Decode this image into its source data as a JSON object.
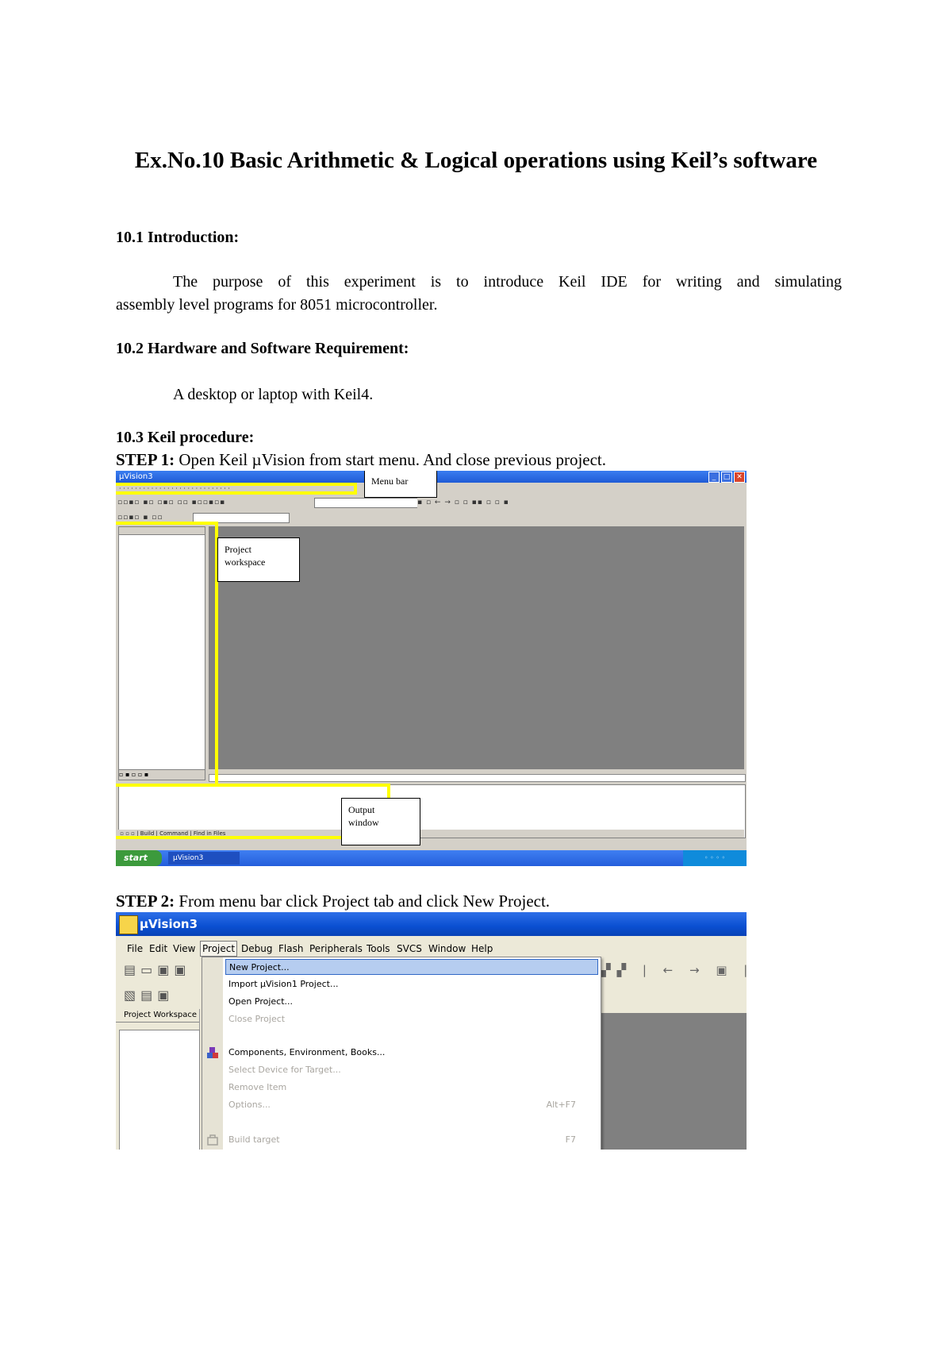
{
  "doc": {
    "title": "Ex.No.10 Basic Arithmetic & Logical operations using Keil’s software",
    "s1_heading": "10.1 Introduction:",
    "s1_text_a": "The purpose of this experiment is to introduce Keil IDE for writing and simulating",
    "s1_text_b": "assembly level programs for 8051 microcontroller.",
    "s2_heading": "10.2 Hardware and Software Requirement:",
    "s2_text": "A desktop or laptop with Keil4.",
    "s3_heading": "10.3   Keil procedure:",
    "step1_label": "STEP 1:",
    "step1_text": " Open Keil µVision from start menu. And close previous project.",
    "step2_label": "STEP 2:",
    "step2_text": " From menu bar click Project tab and click New Project."
  },
  "shot1": {
    "window_title": "µVision3",
    "callout_menu": "Menu bar",
    "callout_workspace_a": "Project",
    "callout_workspace_b": "workspace",
    "callout_output_a": "Output",
    "callout_output_b": "window",
    "start_label": "start",
    "task_label": "µVision3",
    "highlight_color": "#ffff00"
  },
  "shot2": {
    "window_title": "µVision3",
    "menu": [
      "File",
      "Edit",
      "View",
      "Project",
      "Debug",
      "Flash",
      "Peripherals",
      "Tools",
      "SVCS",
      "Window",
      "Help"
    ],
    "workspace_label": "Project Workspace",
    "dropdown": [
      {
        "label": "New Project...",
        "state": "selected",
        "key": ""
      },
      {
        "label": "Import µVision1 Project...",
        "state": "normal",
        "key": ""
      },
      {
        "label": "Open Project...",
        "state": "normal",
        "key": ""
      },
      {
        "label": "Close Project",
        "state": "disabled",
        "key": ""
      },
      {
        "label": "Components, Environment, Books...",
        "state": "normal",
        "key": ""
      },
      {
        "label": "Select Device for Target...",
        "state": "disabled",
        "key": ""
      },
      {
        "label": "Remove Item",
        "state": "disabled",
        "key": ""
      },
      {
        "label": "Options...",
        "state": "disabled",
        "key": "Alt+F7"
      },
      {
        "label": "Build target",
        "state": "disabled",
        "key": "F7"
      }
    ]
  }
}
